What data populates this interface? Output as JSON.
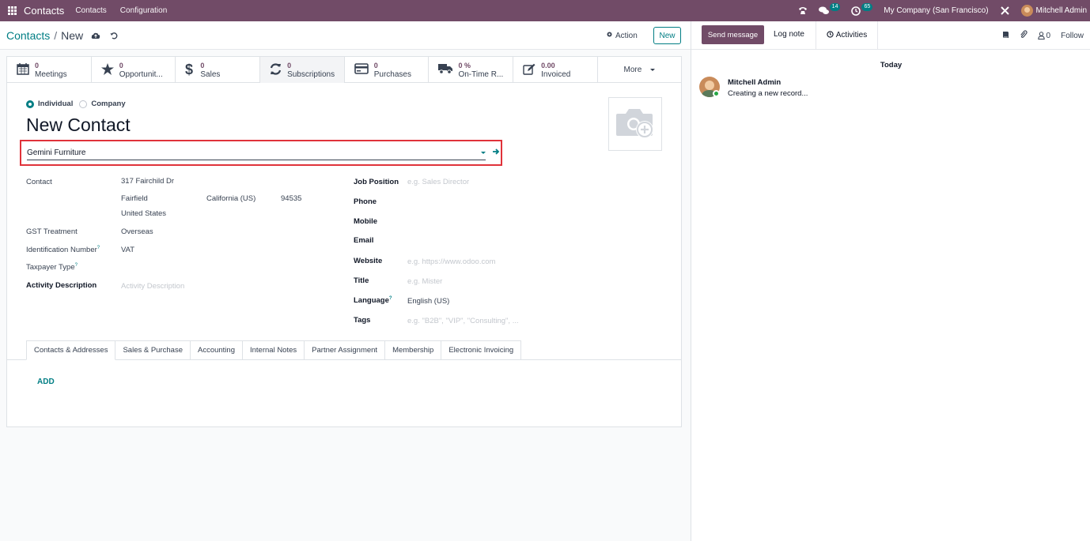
{
  "topbar": {
    "app_name": "Contacts",
    "menu": [
      "Contacts",
      "Configuration"
    ],
    "messages_count": "14",
    "activities_count": "65",
    "company": "My Company (San Francisco)",
    "user": "Mitchell Admin"
  },
  "breadcrumb": {
    "parent": "Contacts",
    "separator": "/",
    "current": "New"
  },
  "control": {
    "action_label": "Action",
    "new_label": "New"
  },
  "smart_buttons": [
    {
      "value": "0",
      "label": "Meetings",
      "icon": "calendar-icon"
    },
    {
      "value": "0",
      "label": "Opportunit...",
      "icon": "star-icon"
    },
    {
      "value": "0",
      "label": "Sales",
      "icon": "dollar-icon"
    },
    {
      "value": "0",
      "label": "Subscriptions",
      "icon": "refresh-icon"
    },
    {
      "value": "0",
      "label": "Purchases",
      "icon": "credit-card-icon"
    },
    {
      "value": "0 %",
      "label": "On-Time R...",
      "icon": "truck-icon"
    },
    {
      "value": "0.00",
      "label": "Invoiced",
      "icon": "edit-icon"
    }
  ],
  "more_label": "More",
  "form": {
    "type_options": [
      "Individual",
      "Company"
    ],
    "selected_type": "Individual",
    "title": "New Contact",
    "company_value": "Gemini Furniture",
    "left_fields": {
      "contact_label": "Contact",
      "street": "317 Fairchild Dr",
      "city": "Fairfield",
      "state": "California (US)",
      "zip": "94535",
      "country": "United States",
      "gst_label": "GST Treatment",
      "gst_value": "Overseas",
      "idnum_label": "Identification Number",
      "idnum_value": "VAT",
      "taxpayer_label": "Taxpayer Type",
      "activity_label": "Activity Description",
      "activity_placeholder": "Activity Description"
    },
    "right_fields": {
      "job_label": "Job Position",
      "job_placeholder": "e.g. Sales Director",
      "phone_label": "Phone",
      "mobile_label": "Mobile",
      "email_label": "Email",
      "website_label": "Website",
      "website_placeholder": "e.g. https://www.odoo.com",
      "title_label": "Title",
      "title_placeholder": "e.g. Mister",
      "language_label": "Language",
      "language_value": "English (US)",
      "tags_label": "Tags",
      "tags_placeholder": "e.g. \"B2B\", \"VIP\", \"Consulting\", ..."
    }
  },
  "tabs": [
    "Contacts & Addresses",
    "Sales & Purchase",
    "Accounting",
    "Internal Notes",
    "Partner Assignment",
    "Membership",
    "Electronic Invoicing"
  ],
  "add_label": "ADD",
  "chatter": {
    "send_message": "Send message",
    "log_note": "Log note",
    "activities": "Activities",
    "followers_count": "0",
    "follow": "Follow",
    "date_separator": "Today",
    "author": "Mitchell Admin",
    "message": "Creating a new record..."
  },
  "colors": {
    "brand": "#714b67",
    "accent": "#017e84",
    "highlight": "#e0323a"
  }
}
